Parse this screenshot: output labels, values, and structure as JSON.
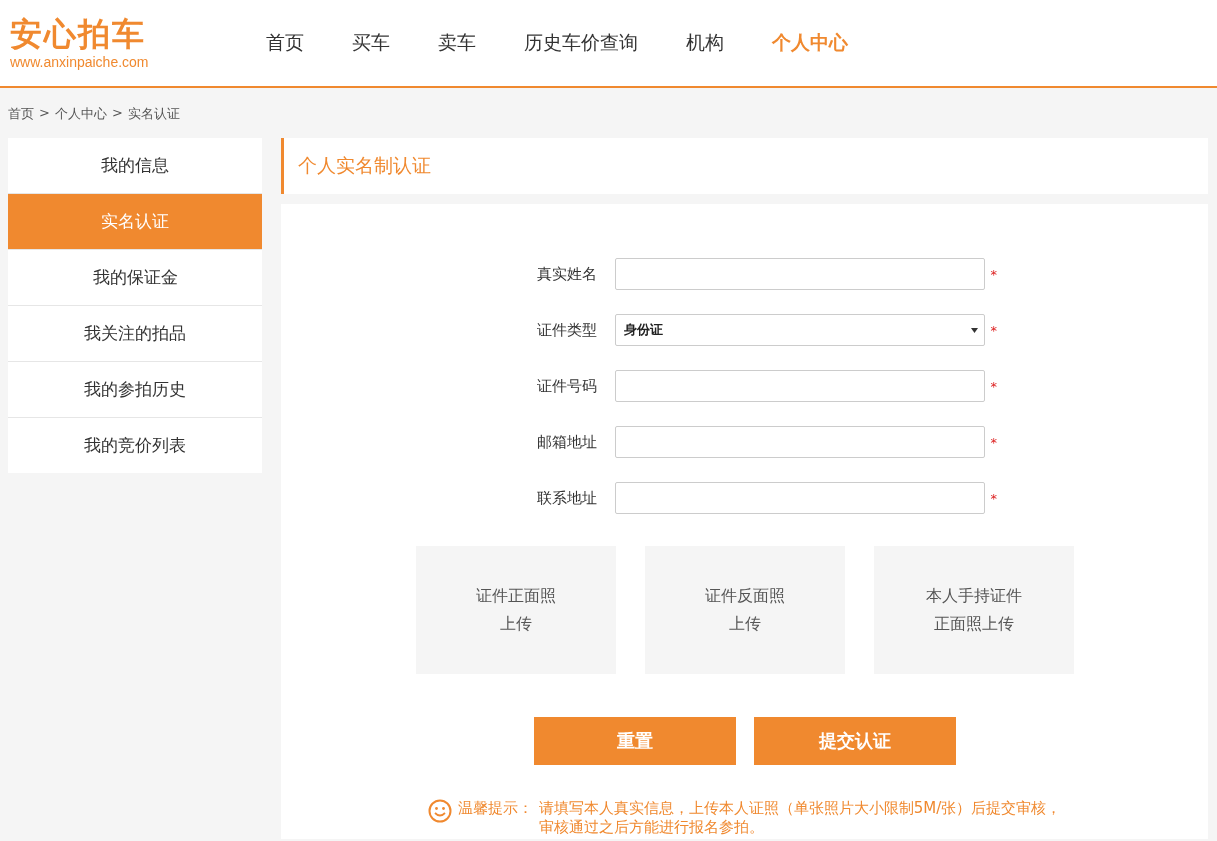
{
  "logo": {
    "name": "安心拍车",
    "url": "www.anxinpaiche.com"
  },
  "nav": [
    {
      "label": "首页",
      "selected": false
    },
    {
      "label": "买车",
      "selected": false
    },
    {
      "label": "卖车",
      "selected": false
    },
    {
      "label": "历史车价查询",
      "selected": false
    },
    {
      "label": "机构",
      "selected": false
    },
    {
      "label": "个人中心",
      "selected": true
    }
  ],
  "breadcrumb": {
    "items": [
      "首页",
      "个人中心",
      "实名认证"
    ],
    "separator": ">"
  },
  "sidebar": {
    "items": [
      {
        "label": "我的信息",
        "selected": false
      },
      {
        "label": "实名认证",
        "selected": true
      },
      {
        "label": "我的保证金",
        "selected": false
      },
      {
        "label": "我关注的拍品",
        "selected": false
      },
      {
        "label": "我的参拍历史",
        "selected": false
      },
      {
        "label": "我的竞价列表",
        "selected": false
      }
    ]
  },
  "panel_title": "个人实名制认证",
  "form": {
    "fields": [
      {
        "kind": "text",
        "label": "真实姓名",
        "required_mark": "*"
      },
      {
        "kind": "select",
        "label": "证件类型",
        "value": "身份证",
        "required_mark": "*"
      },
      {
        "kind": "text",
        "label": "证件号码",
        "required_mark": "*"
      },
      {
        "kind": "text",
        "label": "邮箱地址",
        "required_mark": "*"
      },
      {
        "kind": "text",
        "label": "联系地址",
        "required_mark": "*"
      }
    ],
    "uploads": [
      [
        "证件正面照",
        "上传"
      ],
      [
        "证件反面照",
        "上传"
      ],
      [
        "本人手持证件",
        "正面照上传"
      ]
    ],
    "buttons": [
      "重置",
      "提交认证"
    ],
    "tip": {
      "title": "温馨提示：",
      "lines": [
        "请填写本人真实信息，上传本人证照（单张照片大小限制5M/张）后提交审核，",
        "审核通过之后方能进行报名参拍。"
      ]
    }
  }
}
